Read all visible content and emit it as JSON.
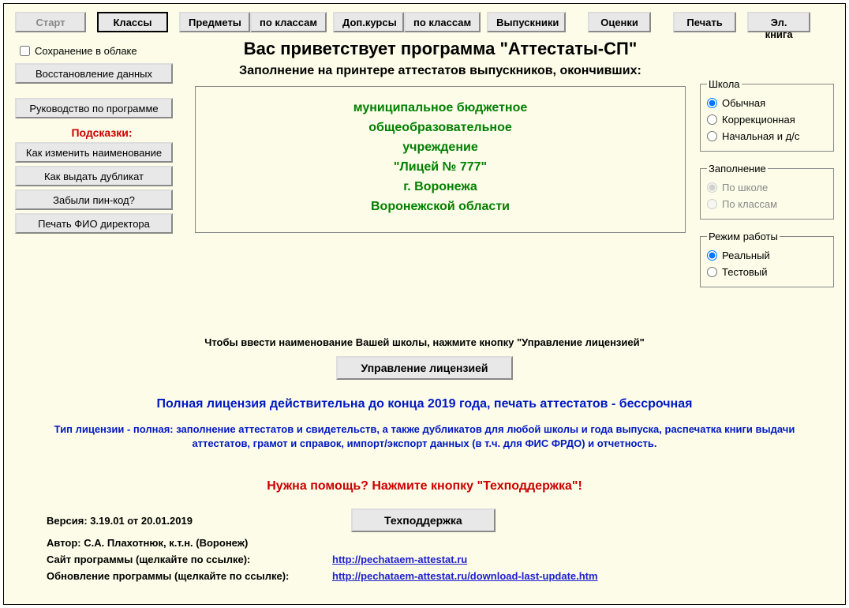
{
  "toolbar": {
    "start": "Старт",
    "classes": "Классы",
    "subjects": "Предметы",
    "by_classes1": "по классам",
    "extra": "Доп.курсы",
    "by_classes2": "по классам",
    "grads": "Выпускники",
    "grades": "Оценки",
    "print": "Печать",
    "ebook": "Эл. книга"
  },
  "left": {
    "cloud": "Сохранение  в облаке",
    "restore": "Восстановление данных",
    "manual": "Руководство по программе",
    "tips_hdr": "Подсказки:",
    "tip1": "Как изменить наименование",
    "tip2": "Как выдать дубликат",
    "tip3": "Забыли пин-код?",
    "tip4": "Печать ФИО директора"
  },
  "main": {
    "title": "Вас приветствует программа \"Аттестаты-СП\"",
    "sub": "Заполнение на принтере аттестатов выпускников, окончивших:",
    "school": {
      "l1": "муниципальное бюджетное",
      "l2": "общеобразовательное",
      "l3": "учреждение",
      "l4": "\"Лицей № 777\"",
      "l5": "г. Воронежа",
      "l6": "Воронежской области"
    }
  },
  "right": {
    "school_legend": "Школа",
    "school_opt1": "Обычная",
    "school_opt2": "Коррекционная",
    "school_opt3": "Начальная и д/с",
    "fill_legend": "Заполнение",
    "fill_opt1": "По школе",
    "fill_opt2": "По классам",
    "mode_legend": "Режим работы",
    "mode_opt1": "Реальный",
    "mode_opt2": "Тестовый"
  },
  "bottom": {
    "hint": "Чтобы ввести наименование Вашей школы, нажмите кнопку \"Управление лицензией\"",
    "license_btn": "Управление лицензией",
    "license_full": "Полная лицензия действительна до конца 2019 года, печать аттестатов - бессрочная",
    "license_type": "Тип лицензии - полная: заполнение аттестатов и свидетельств, а также дубликатов для любой школы и года выпуска, распечатка книги выдачи аттестатов, грамот и справок, импорт/экспорт данных (в т.ч. для ФИС ФРДО) и отчетность.",
    "help": "Нужна помощь? Нажмите кнопку \"Техподдержка\"!",
    "tech_btn": "Техподдержка",
    "version_lbl": "Версия:   3.19.01  от  20.01.2019",
    "author_lbl": "Автор: С.А. Плахотнюк, к.т.н. (Воронеж)",
    "site_lbl": "Сайт программы (щелкайте по ссылке):",
    "site_url": "http://pechataem-attestat.ru",
    "upd_lbl": "Обновление программы (щелкайте по ссылке):",
    "upd_url": "http://pechataem-attestat.ru/download-last-update.htm"
  }
}
